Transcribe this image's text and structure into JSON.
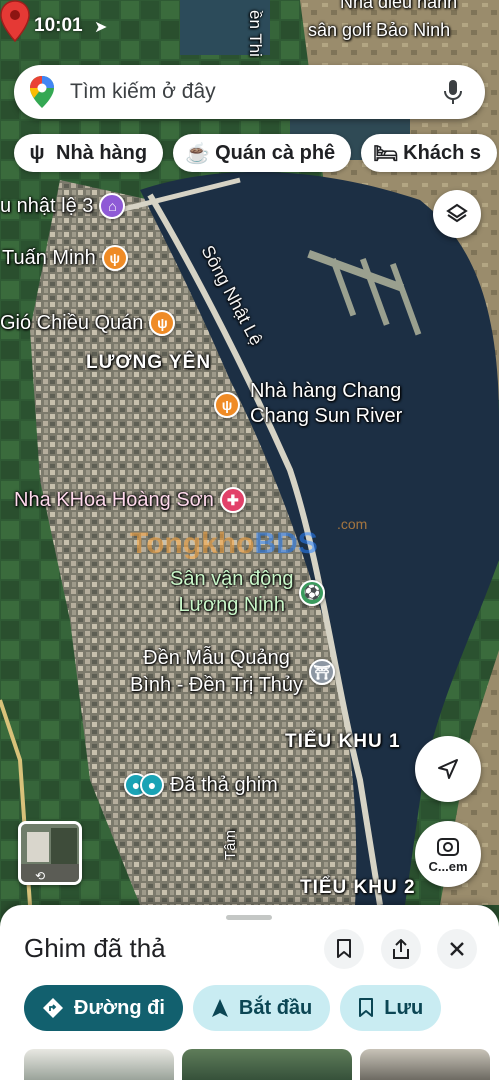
{
  "status_bar": {
    "time": "10:01"
  },
  "search": {
    "placeholder": "Tìm kiếm ở đây"
  },
  "chips": [
    {
      "icon": "restaurant-icon",
      "label": "Nhà hàng"
    },
    {
      "icon": "cafe-icon",
      "label": "Quán cà phê"
    },
    {
      "icon": "hotel-icon",
      "label": "Khách s"
    }
  ],
  "map_labels": {
    "top_road": "ền Thi",
    "top_golf_1": "Nhà điều hành",
    "top_golf_2": "sân golf Bảo Ninh",
    "river": "Sông Nhật Lệ",
    "luong_yen": "LƯƠNG YÊN",
    "tieu_khu_1": "TIỂU KHU 1",
    "tieu_khu_2": "TIỂU KHU 2",
    "tam_road": "Tâm"
  },
  "pois": [
    {
      "id": "nhat-le",
      "label": "u nhật lệ 3",
      "icon": "landmark-icon"
    },
    {
      "id": "tuan-minh",
      "label": "Tuấn Minh",
      "icon": "restaurant-icon"
    },
    {
      "id": "gio-chieu",
      "label": "Gió Chiều Quán",
      "icon": "restaurant-icon"
    },
    {
      "id": "chang-chang",
      "label_line1": "Nhà hàng Chang",
      "label_line2": "Chang Sun River",
      "icon": "restaurant-icon"
    },
    {
      "id": "nha-khoa",
      "label": "Nha KHoa Hoàng Sơn",
      "icon": "hospital-icon"
    },
    {
      "id": "san-van-dong",
      "label_line1": "Sân vận động",
      "label_line2": "Lương Ninh",
      "icon": "stadium-icon"
    },
    {
      "id": "den-mau",
      "label_line1": "Đền Mẫu Quảng",
      "label_line2": "Bình - Đền Trị Thủy",
      "icon": "temple-icon"
    },
    {
      "id": "da-tha-ghim",
      "label": "Đã thả ghim",
      "icon": "dropped-pin-icon"
    }
  ],
  "watermark": {
    "part1": "Tongkho",
    "part2": "BDS",
    "sub": ".com"
  },
  "lens_label": "C...em",
  "sheet": {
    "title": "Ghim đã thả",
    "actions": [
      {
        "label": "Đường đi",
        "style": "primary",
        "icon": "directions-icon"
      },
      {
        "label": "Bắt đầu",
        "style": "secondary",
        "icon": "navigation-icon"
      },
      {
        "label": "Lưu",
        "style": "secondary",
        "icon": "bookmark-icon"
      }
    ]
  },
  "colors": {
    "sheet_primary": "#12606e",
    "sheet_secondary": "#c9ecf2",
    "pin_red": "#e53935"
  }
}
